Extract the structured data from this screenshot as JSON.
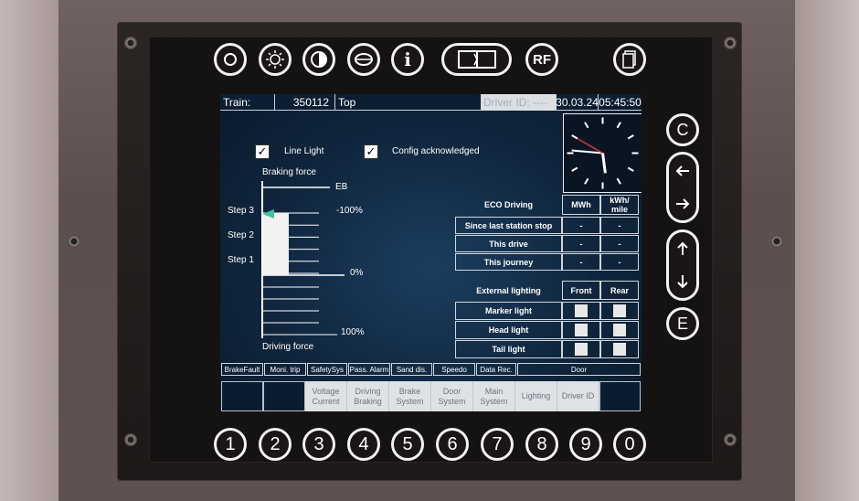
{
  "top_buttons": [
    {
      "name": "circle-icon"
    },
    {
      "name": "brightness-icon"
    },
    {
      "name": "contrast-icon"
    },
    {
      "name": "speaker-icon"
    },
    {
      "name": "info-icon",
      "glyph": "i"
    },
    {
      "name": "display-toggle-icon"
    },
    {
      "name": "rf",
      "label": "RF"
    },
    {
      "name": "document-icon"
    }
  ],
  "side_buttons": {
    "c": "C",
    "e": "E"
  },
  "number_buttons": [
    "1",
    "2",
    "3",
    "4",
    "5",
    "6",
    "7",
    "8",
    "9",
    "0"
  ],
  "header": {
    "train_label": "Train:",
    "train_number": "350112",
    "mode": "Top",
    "driver_label": "Driver ID: ----",
    "date": "30.03.24",
    "time": "05:45:50"
  },
  "clock": {
    "hour": 5,
    "minute": 45,
    "second": 50
  },
  "checkboxes": [
    {
      "label": "Line Light",
      "checked": true
    },
    {
      "label": "Config acknowledged",
      "checked": true
    }
  ],
  "force_gauge": {
    "braking_label": "Braking force",
    "driving_label": "Driving force",
    "eb_label": "EB",
    "minus100_label": "-100%",
    "zero_label": "0%",
    "plus100_label": "100%",
    "steps": [
      "Step 3",
      "Step 2",
      "Step 1"
    ],
    "current_brake_step": 3
  },
  "eco_table": {
    "title": "ECO Driving",
    "col1": "MWh",
    "col2": "kWh/\nmile",
    "rows": [
      {
        "label": "Since last station stop",
        "v1": "-",
        "v2": "-"
      },
      {
        "label": "This drive",
        "v1": "-",
        "v2": "-"
      },
      {
        "label": "This journey",
        "v1": "-",
        "v2": "-"
      }
    ]
  },
  "lighting_table": {
    "title": "External lighting",
    "col1": "Front",
    "col2": "Rear",
    "rows": [
      {
        "label": "Marker light"
      },
      {
        "label": "Head light"
      },
      {
        "label": "Tail light"
      }
    ]
  },
  "status_bar": [
    "BrakeFault",
    "Moni. trip",
    "SafetySys",
    "Pass. Alarm",
    "Sand dis.",
    "Speedo",
    "Data Rec.",
    "Door"
  ],
  "softkeys": [
    "",
    "",
    "Voltage\nCurrent",
    "Driving\nBraking",
    "Brake\nSystem",
    "Door\nSystem",
    "Main\nSystem",
    "Lighting",
    "Driver ID",
    ""
  ],
  "colors": {
    "screen_bg": "#10263e",
    "accent_arrow": "#3fc3a4",
    "clock_second_hand": "#d23a3a"
  }
}
